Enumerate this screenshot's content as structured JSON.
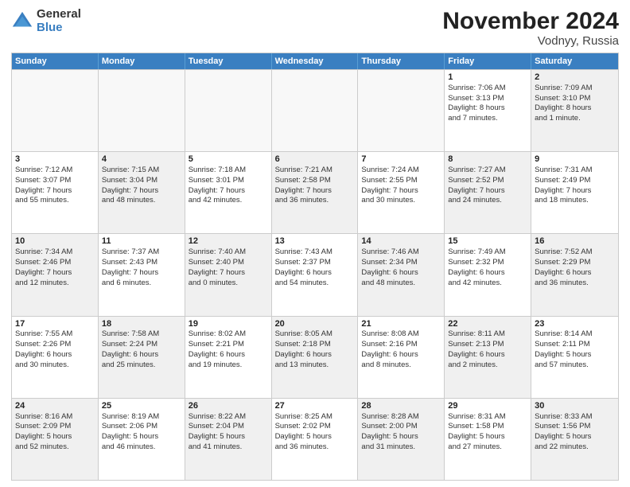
{
  "logo": {
    "general": "General",
    "blue": "Blue"
  },
  "title": "November 2024",
  "subtitle": "Vodnyy, Russia",
  "header": {
    "days": [
      "Sunday",
      "Monday",
      "Tuesday",
      "Wednesday",
      "Thursday",
      "Friday",
      "Saturday"
    ]
  },
  "rows": [
    [
      {
        "day": "",
        "empty": true
      },
      {
        "day": "",
        "empty": true
      },
      {
        "day": "",
        "empty": true
      },
      {
        "day": "",
        "empty": true
      },
      {
        "day": "",
        "empty": true
      },
      {
        "day": "1",
        "line1": "Sunrise: 7:06 AM",
        "line2": "Sunset: 3:13 PM",
        "line3": "Daylight: 8 hours",
        "line4": "and 7 minutes."
      },
      {
        "day": "2",
        "line1": "Sunrise: 7:09 AM",
        "line2": "Sunset: 3:10 PM",
        "line3": "Daylight: 8 hours",
        "line4": "and 1 minute.",
        "shaded": true
      }
    ],
    [
      {
        "day": "3",
        "line1": "Sunrise: 7:12 AM",
        "line2": "Sunset: 3:07 PM",
        "line3": "Daylight: 7 hours",
        "line4": "and 55 minutes."
      },
      {
        "day": "4",
        "line1": "Sunrise: 7:15 AM",
        "line2": "Sunset: 3:04 PM",
        "line3": "Daylight: 7 hours",
        "line4": "and 48 minutes.",
        "shaded": true
      },
      {
        "day": "5",
        "line1": "Sunrise: 7:18 AM",
        "line2": "Sunset: 3:01 PM",
        "line3": "Daylight: 7 hours",
        "line4": "and 42 minutes."
      },
      {
        "day": "6",
        "line1": "Sunrise: 7:21 AM",
        "line2": "Sunset: 2:58 PM",
        "line3": "Daylight: 7 hours",
        "line4": "and 36 minutes.",
        "shaded": true
      },
      {
        "day": "7",
        "line1": "Sunrise: 7:24 AM",
        "line2": "Sunset: 2:55 PM",
        "line3": "Daylight: 7 hours",
        "line4": "and 30 minutes."
      },
      {
        "day": "8",
        "line1": "Sunrise: 7:27 AM",
        "line2": "Sunset: 2:52 PM",
        "line3": "Daylight: 7 hours",
        "line4": "and 24 minutes.",
        "shaded": true
      },
      {
        "day": "9",
        "line1": "Sunrise: 7:31 AM",
        "line2": "Sunset: 2:49 PM",
        "line3": "Daylight: 7 hours",
        "line4": "and 18 minutes."
      }
    ],
    [
      {
        "day": "10",
        "line1": "Sunrise: 7:34 AM",
        "line2": "Sunset: 2:46 PM",
        "line3": "Daylight: 7 hours",
        "line4": "and 12 minutes.",
        "shaded": true
      },
      {
        "day": "11",
        "line1": "Sunrise: 7:37 AM",
        "line2": "Sunset: 2:43 PM",
        "line3": "Daylight: 7 hours",
        "line4": "and 6 minutes."
      },
      {
        "day": "12",
        "line1": "Sunrise: 7:40 AM",
        "line2": "Sunset: 2:40 PM",
        "line3": "Daylight: 7 hours",
        "line4": "and 0 minutes.",
        "shaded": true
      },
      {
        "day": "13",
        "line1": "Sunrise: 7:43 AM",
        "line2": "Sunset: 2:37 PM",
        "line3": "Daylight: 6 hours",
        "line4": "and 54 minutes."
      },
      {
        "day": "14",
        "line1": "Sunrise: 7:46 AM",
        "line2": "Sunset: 2:34 PM",
        "line3": "Daylight: 6 hours",
        "line4": "and 48 minutes.",
        "shaded": true
      },
      {
        "day": "15",
        "line1": "Sunrise: 7:49 AM",
        "line2": "Sunset: 2:32 PM",
        "line3": "Daylight: 6 hours",
        "line4": "and 42 minutes."
      },
      {
        "day": "16",
        "line1": "Sunrise: 7:52 AM",
        "line2": "Sunset: 2:29 PM",
        "line3": "Daylight: 6 hours",
        "line4": "and 36 minutes.",
        "shaded": true
      }
    ],
    [
      {
        "day": "17",
        "line1": "Sunrise: 7:55 AM",
        "line2": "Sunset: 2:26 PM",
        "line3": "Daylight: 6 hours",
        "line4": "and 30 minutes."
      },
      {
        "day": "18",
        "line1": "Sunrise: 7:58 AM",
        "line2": "Sunset: 2:24 PM",
        "line3": "Daylight: 6 hours",
        "line4": "and 25 minutes.",
        "shaded": true
      },
      {
        "day": "19",
        "line1": "Sunrise: 8:02 AM",
        "line2": "Sunset: 2:21 PM",
        "line3": "Daylight: 6 hours",
        "line4": "and 19 minutes."
      },
      {
        "day": "20",
        "line1": "Sunrise: 8:05 AM",
        "line2": "Sunset: 2:18 PM",
        "line3": "Daylight: 6 hours",
        "line4": "and 13 minutes.",
        "shaded": true
      },
      {
        "day": "21",
        "line1": "Sunrise: 8:08 AM",
        "line2": "Sunset: 2:16 PM",
        "line3": "Daylight: 6 hours",
        "line4": "and 8 minutes."
      },
      {
        "day": "22",
        "line1": "Sunrise: 8:11 AM",
        "line2": "Sunset: 2:13 PM",
        "line3": "Daylight: 6 hours",
        "line4": "and 2 minutes.",
        "shaded": true
      },
      {
        "day": "23",
        "line1": "Sunrise: 8:14 AM",
        "line2": "Sunset: 2:11 PM",
        "line3": "Daylight: 5 hours",
        "line4": "and 57 minutes."
      }
    ],
    [
      {
        "day": "24",
        "line1": "Sunrise: 8:16 AM",
        "line2": "Sunset: 2:09 PM",
        "line3": "Daylight: 5 hours",
        "line4": "and 52 minutes.",
        "shaded": true
      },
      {
        "day": "25",
        "line1": "Sunrise: 8:19 AM",
        "line2": "Sunset: 2:06 PM",
        "line3": "Daylight: 5 hours",
        "line4": "and 46 minutes."
      },
      {
        "day": "26",
        "line1": "Sunrise: 8:22 AM",
        "line2": "Sunset: 2:04 PM",
        "line3": "Daylight: 5 hours",
        "line4": "and 41 minutes.",
        "shaded": true
      },
      {
        "day": "27",
        "line1": "Sunrise: 8:25 AM",
        "line2": "Sunset: 2:02 PM",
        "line3": "Daylight: 5 hours",
        "line4": "and 36 minutes."
      },
      {
        "day": "28",
        "line1": "Sunrise: 8:28 AM",
        "line2": "Sunset: 2:00 PM",
        "line3": "Daylight: 5 hours",
        "line4": "and 31 minutes.",
        "shaded": true
      },
      {
        "day": "29",
        "line1": "Sunrise: 8:31 AM",
        "line2": "Sunset: 1:58 PM",
        "line3": "Daylight: 5 hours",
        "line4": "and 27 minutes."
      },
      {
        "day": "30",
        "line1": "Sunrise: 8:33 AM",
        "line2": "Sunset: 1:56 PM",
        "line3": "Daylight: 5 hours",
        "line4": "and 22 minutes.",
        "shaded": true
      }
    ]
  ]
}
